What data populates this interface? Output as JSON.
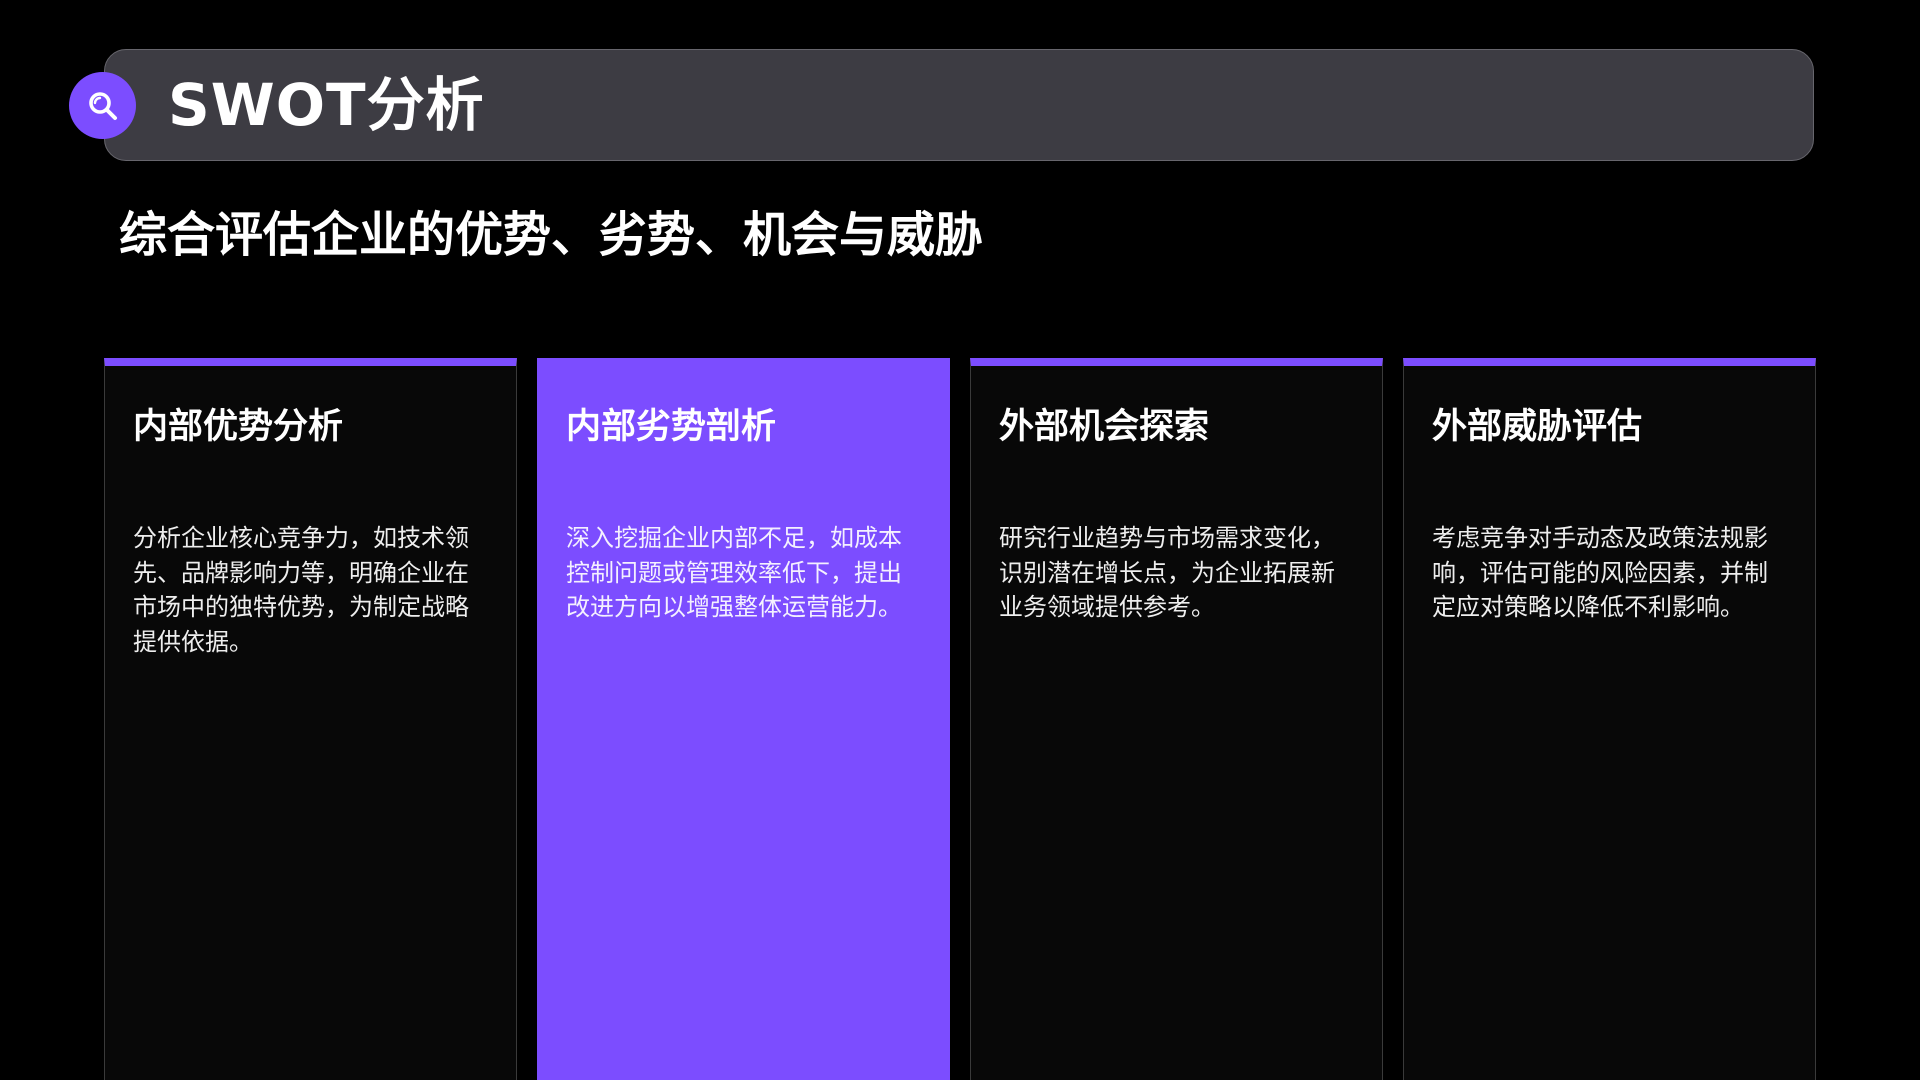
{
  "header": {
    "title": "SWOT分析",
    "icon": "search-icon",
    "accent_color": "#7c4dff"
  },
  "subtitle": "综合评估企业的优势、劣势、机会与威胁",
  "cards": [
    {
      "title": "内部优势分析",
      "description": "分析企业核心竞争力，如技术领先、品牌影响力等，明确企业在市场中的独特优势，为制定战略提供依据。",
      "highlighted": false
    },
    {
      "title": "内部劣势剖析",
      "description": "深入挖掘企业内部不足，如成本控制问题或管理效率低下，提出改进方向以增强整体运营能力。",
      "highlighted": true
    },
    {
      "title": "外部机会探索",
      "description": "研究行业趋势与市场需求变化，识别潜在增长点，为企业拓展新业务领域提供参考。",
      "highlighted": false
    },
    {
      "title": "外部威胁评估",
      "description": "考虑竞争对手动态及政策法规影响，评估可能的风险因素，并制定应对策略以降低不利影响。",
      "highlighted": false
    }
  ],
  "colors": {
    "background": "#000000",
    "title_bar": "#3d3c43",
    "card_background": "#080808",
    "accent": "#7c4dff"
  }
}
